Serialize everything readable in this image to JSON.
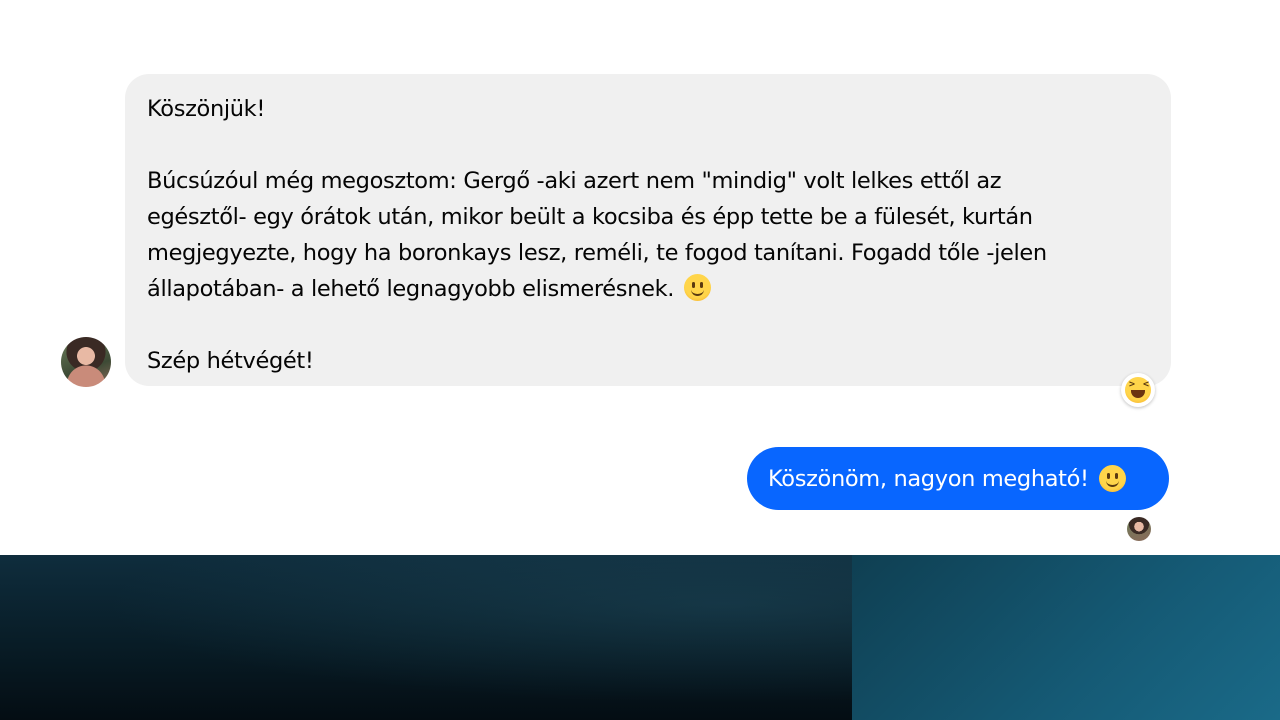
{
  "conversation": {
    "incoming_message": {
      "line1": "Köszönjük!",
      "paragraph_lines": [
        "Búcsúzóul még megosztom: Gergő -aki azert nem \"mindig\" volt lelkes ettől az",
        "egésztől- egy órátok után, mikor beült a kocsiba és épp tette be a fülesét, kurtán",
        "megjegyezte, hogy ha boronkays lesz, reméli, te fogod tanítani. Fogadd tőle -jelen",
        "állapotában- a lehető legnagyobb elismerésnek."
      ],
      "closing": "Szép hétvégét!",
      "inline_emoji": "slightly-smiling-face-icon",
      "reaction_emoji": "laughing-face-icon"
    },
    "outgoing_message": {
      "text": "Köszönöm, nagyon megható!",
      "inline_emoji": "slightly-smiling-face-icon"
    }
  },
  "colors": {
    "incoming_bubble": "#f0f0f0",
    "outgoing_bubble": "#0866ff",
    "background": "#ffffff"
  }
}
